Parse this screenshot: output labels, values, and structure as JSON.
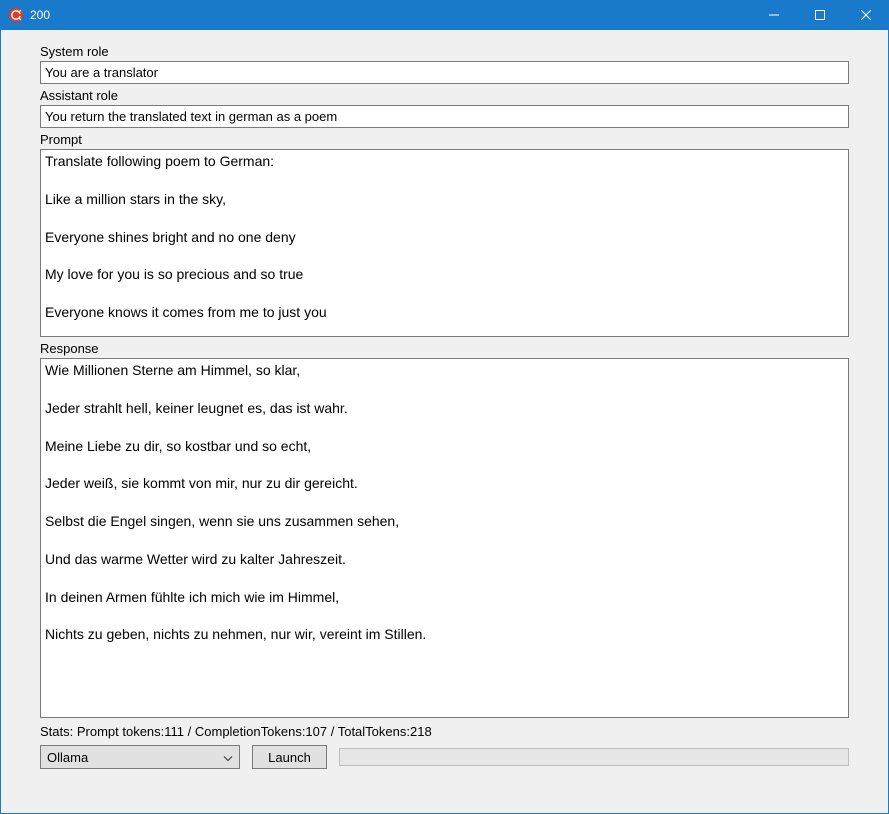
{
  "window": {
    "title": "200"
  },
  "labels": {
    "system_role": "System role",
    "assistant_role": "Assistant role",
    "prompt": "Prompt",
    "response": "Response"
  },
  "fields": {
    "system_role": "You are a translator",
    "assistant_role": "You return the translated text in german as a poem",
    "prompt": "Translate following poem to German:\n\nLike a million stars in the sky,\n\nEveryone shines bright and no one deny\n\nMy love for you is so precious and so true\n\nEveryone knows it comes from me to just you",
    "response": "Wie Millionen Sterne am Himmel, so klar,\n\nJeder strahlt hell, keiner leugnet es, das ist wahr.\n\nMeine Liebe zu dir, so kostbar und so echt,\n\nJeder weiß, sie kommt von mir, nur zu dir gereicht.\n\nSelbst die Engel singen, wenn sie uns zusammen sehen,\n\nUnd das warme Wetter wird zu kalter Jahreszeit.\n\nIn deinen Armen fühlte ich mich wie im Himmel,\n\nNichts zu geben, nichts zu nehmen, nur wir, vereint im Stillen."
  },
  "stats": "Stats: Prompt tokens:111 / CompletionTokens:107 / TotalTokens:218",
  "provider": {
    "selected": "Ollama"
  },
  "buttons": {
    "launch": "Launch"
  },
  "colors": {
    "titlebar": "#1979ca"
  }
}
